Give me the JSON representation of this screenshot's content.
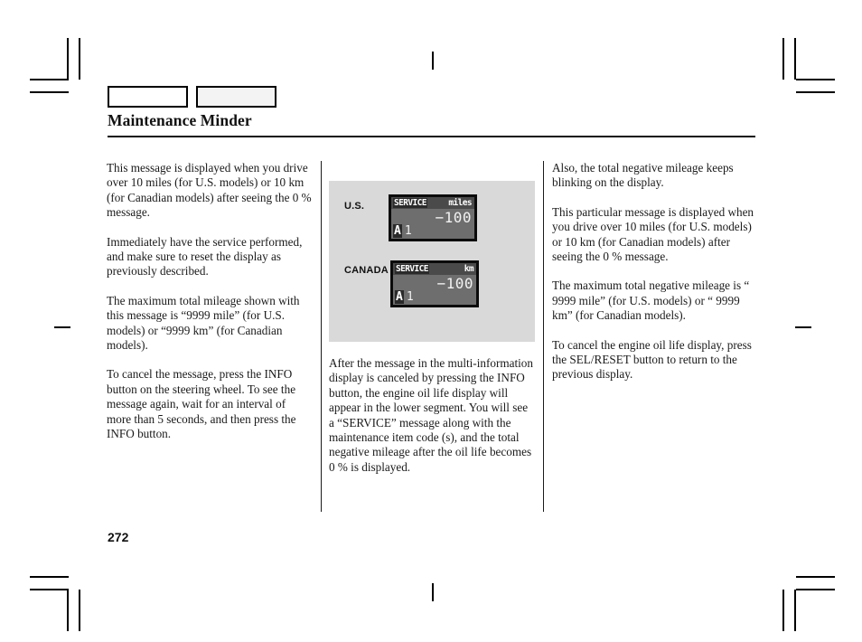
{
  "document": {
    "title": "Maintenance Minder",
    "page_number": "272"
  },
  "header": {
    "tab_left_label": "",
    "tab_right_label": ""
  },
  "columns": {
    "left": [
      "This message is displayed when you drive over 10 miles (for U.S. models) or 10 km (for Canadian models) after seeing the 0 % message.",
      "Immediately have the service performed, and make sure to reset the display as previously described.",
      "The maximum total mileage shown with this message is “9999 mile” (for U.S. models) or “9999 km” (for Canadian models).",
      "To cancel the message, press the INFO button on the steering wheel. To see the message again, wait for an interval of more than 5 seconds, and then press the INFO button."
    ],
    "middle": [
      "After the message in the multi-information display is canceled by pressing the INFO button, the engine oil life display will appear in the lower segment. You will see a “SERVICE” message along with the maintenance item code (s), and the total negative mileage after the oil life becomes 0 % is displayed."
    ],
    "right": [
      "Also, the total negative mileage keeps blinking on the display.",
      "This particular message is displayed when you drive over 10 miles (for U.S. models) or 10 km (for Canadian models) after seeing the 0 % message.",
      "The maximum total negative mileage is “  9999 mile” (for U.S. models) or “  9999 km” (for Canadian models).",
      "To cancel the engine oil life display, press the SEL/RESET button to return to the previous display."
    ]
  },
  "figure": {
    "background_color": "#d9d9d9",
    "us": {
      "region_label": "U.S.",
      "service_text": "SERVICE",
      "unit_text": "miles",
      "value_text": "−100",
      "code_letter": "A",
      "code_number": "1"
    },
    "canada": {
      "region_label": "CANADA",
      "service_text": "SERVICE",
      "unit_text": "km",
      "value_text": "−100",
      "code_letter": "A",
      "code_number": "1"
    }
  }
}
